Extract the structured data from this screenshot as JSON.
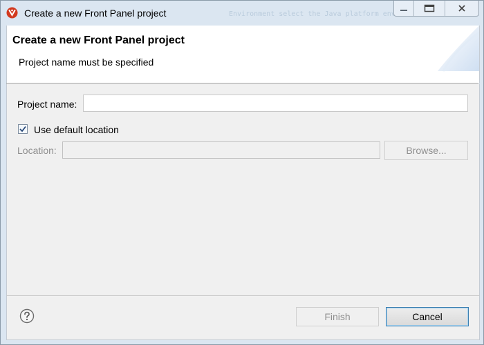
{
  "window": {
    "title": "Create a new Front Panel project",
    "background_text": "Environment  select the Java platform environment"
  },
  "header": {
    "title": "Create a new Front Panel project",
    "message": "Project name must be specified"
  },
  "form": {
    "project_name_label": "Project name:",
    "project_name_value": "",
    "use_default_label": "Use default location",
    "use_default_checked": true,
    "location_label": "Location:",
    "location_value": "",
    "browse_label": "Browse..."
  },
  "footer": {
    "finish_label": "Finish",
    "cancel_label": "Cancel"
  },
  "icons": {
    "app": "eclipse-app-icon",
    "help": "help-icon",
    "minimize": "minimize-icon",
    "maximize": "maximize-icon",
    "close": "close-icon",
    "checkbox": "checkmark-icon"
  },
  "colors": {
    "window_frame": "#dbe6f1",
    "dialog_body": "#f0f0f0",
    "header_bg": "#ffffff",
    "disabled_text": "#8f8f8f",
    "app_icon": "#d23a1f",
    "default_button_border": "#3c7fb1"
  }
}
